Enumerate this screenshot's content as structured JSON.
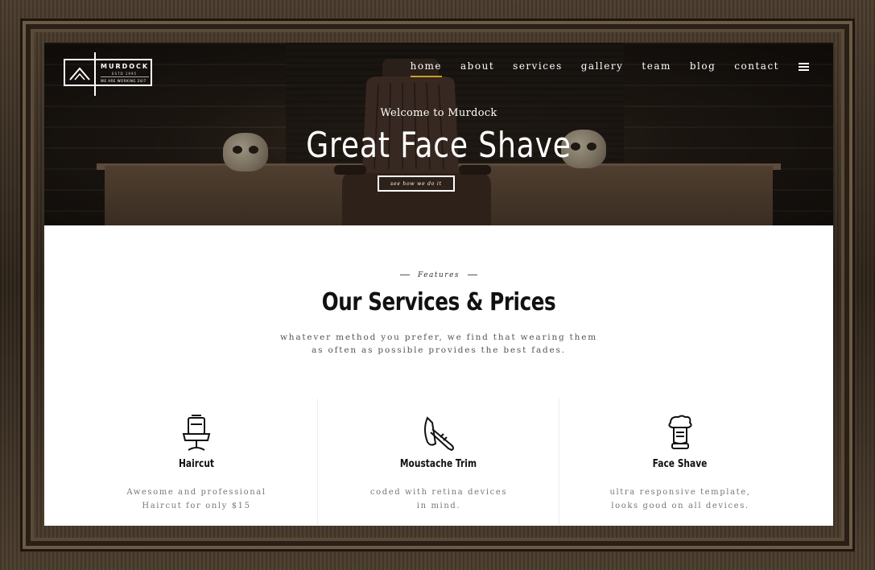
{
  "brand": {
    "name": "MURDOCK",
    "est": "ESTD 1995",
    "tagline": "WE ARE WORKING 24/7"
  },
  "nav": {
    "items": [
      {
        "label": "home",
        "active": true
      },
      {
        "label": "about"
      },
      {
        "label": "services"
      },
      {
        "label": "gallery"
      },
      {
        "label": "team"
      },
      {
        "label": "blog"
      },
      {
        "label": "contact"
      }
    ],
    "menu_icon": "hamburger-icon",
    "accent_color": "#c9a227"
  },
  "hero": {
    "welcome": "Welcome to Murdock",
    "title": "Great Face Shave",
    "cta": "see how we do it"
  },
  "features": {
    "label": "Features",
    "title": "Our Services & Prices",
    "description": "whatever method you prefer, we find that wearing them as often as possible provides the best fades."
  },
  "services": [
    {
      "icon": "barber-chair-icon",
      "title": "Haircut",
      "description": "Awesome and professional Haircut for only $15"
    },
    {
      "icon": "straight-razor-icon",
      "title": "Moustache Trim",
      "description": "coded with retina devices in mind."
    },
    {
      "icon": "shaving-brush-icon",
      "title": "Face Shave",
      "description": "ultra responsive template, looks good on all devices."
    }
  ]
}
